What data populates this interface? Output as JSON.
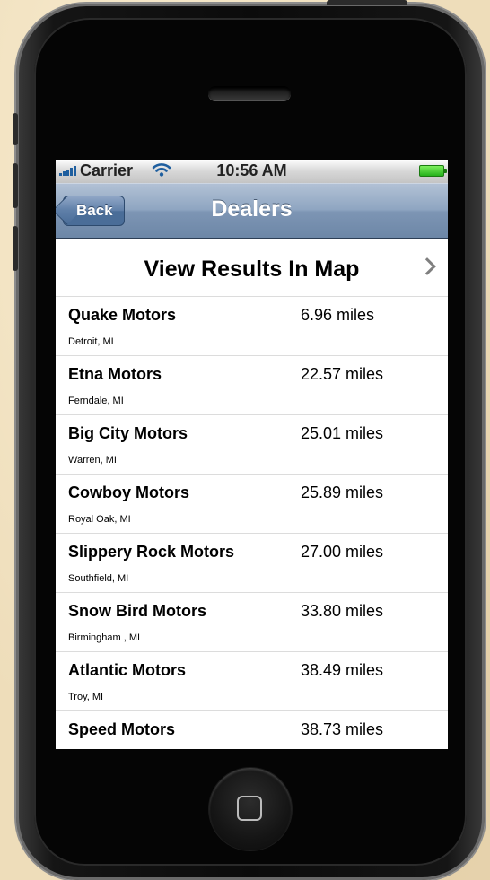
{
  "status_bar": {
    "carrier": "Carrier",
    "time": "10:56 AM"
  },
  "nav_bar": {
    "back_label": "Back",
    "title": "Dealers"
  },
  "map_row": {
    "label": "View Results In Map"
  },
  "dealers": [
    {
      "name": "Quake Motors",
      "distance": "6.96 miles",
      "location": "Detroit, MI"
    },
    {
      "name": "Etna Motors",
      "distance": "22.57 miles",
      "location": "Ferndale, MI"
    },
    {
      "name": "Big City Motors",
      "distance": "25.01 miles",
      "location": "Warren, MI"
    },
    {
      "name": "Cowboy Motors",
      "distance": "25.89 miles",
      "location": "Royal Oak, MI"
    },
    {
      "name": "Slippery Rock Motors",
      "distance": "27.00 miles",
      "location": "Southfield, MI"
    },
    {
      "name": "Snow Bird Motors",
      "distance": "33.80 miles",
      "location": "Birmingham , MI"
    },
    {
      "name": "Atlantic Motors",
      "distance": "38.49 miles",
      "location": "Troy, MI"
    },
    {
      "name": "Speed Motors",
      "distance": "38.73 miles",
      "location": ""
    }
  ],
  "icons": {
    "signal": "signal-bars-icon",
    "wifi": "wifi-icon",
    "battery": "battery-icon",
    "disclosure": "chevron-right-icon",
    "home": "home-button-icon"
  },
  "colors": {
    "nav_bar": "#7d95b4",
    "battery": "#25b11b",
    "background": "#eeddba"
  }
}
